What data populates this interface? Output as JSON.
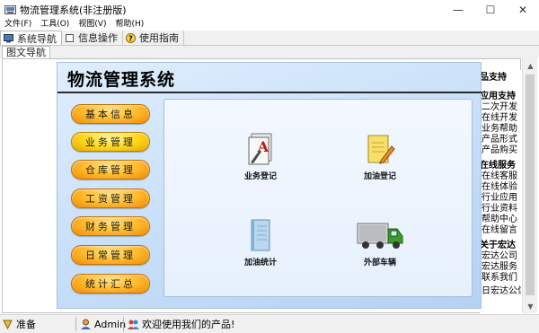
{
  "window": {
    "title": "物流管理系统(非注册版)",
    "minimize_glyph": "—",
    "maximize_glyph": "☐",
    "close_glyph": "✕"
  },
  "menu": {
    "items": [
      "文件(F)",
      "工具(O)",
      "视图(V)",
      "帮助(H)"
    ]
  },
  "toolbar": {
    "tabs": [
      {
        "label": "系统导航",
        "icon": "navigation-monitor-icon"
      },
      {
        "label": "信息操作",
        "icon": "info-square-icon"
      },
      {
        "label": "使用指南",
        "icon": "help-question-icon"
      }
    ]
  },
  "subtab": {
    "label": "图文导航"
  },
  "main": {
    "title": "物流管理系统",
    "nav_buttons": [
      "基本信息",
      "业务管理",
      "仓库管理",
      "工资管理",
      "财务管理",
      "日常管理",
      "统计汇总"
    ],
    "functions": [
      {
        "label": "业务登记",
        "icon": "font-document-icon"
      },
      {
        "label": "加油登记",
        "icon": "notepad-pencil-icon"
      },
      {
        "label": "加油统计",
        "icon": "notebook-icon"
      },
      {
        "label": "外部车辆",
        "icon": "truck-icon"
      }
    ]
  },
  "support": {
    "head_partial": "品支持",
    "sections": [
      {
        "title": "应用支持",
        "items": [
          "二次开发",
          "在线开发",
          "业务帮助",
          "产品形式",
          "产品购买"
        ]
      },
      {
        "title": "在线服务",
        "items": [
          "在线客服",
          "在线体验",
          "行业应用",
          "行业资料",
          "帮助中心",
          "在线留言"
        ]
      },
      {
        "title": "关于宏达",
        "items": [
          "宏达公司",
          "宏达服务",
          "联系我们"
        ]
      }
    ],
    "cut_off_text": "日宏达公信"
  },
  "statusbar": {
    "ready": "准备",
    "user": "Admin",
    "welcome": "欢迎使用我们的产品!"
  }
}
